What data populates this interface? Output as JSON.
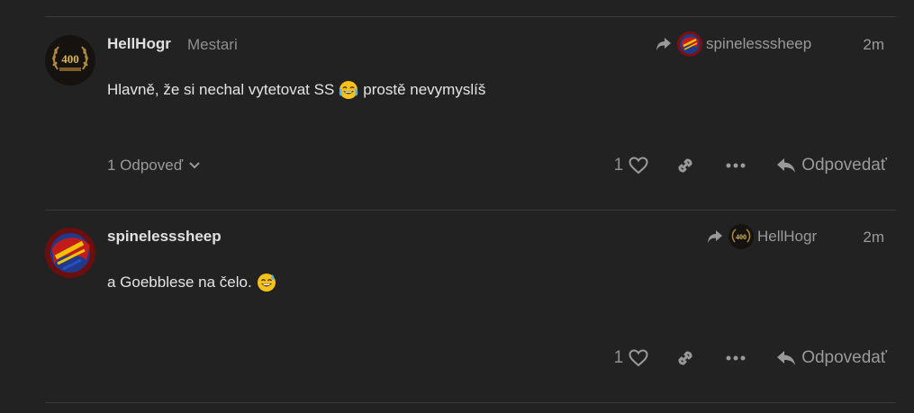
{
  "posts": [
    {
      "username": "HellHogr",
      "user_title": "Mestari",
      "avatar_icon": "gold-400-laurel-badge",
      "reply_to": {
        "username": "spinelesssheep",
        "avatar_icon": "colorful-helmet-avatar"
      },
      "time": "2m",
      "body_before_emoji": "Hlavně, že si nechal vytetovat SS",
      "emoji": "joy-emoji",
      "body_after_emoji": "prostě nevymyslíš",
      "replies_label": "1 Odpoveď",
      "like_count": "1",
      "reply_label": "Odpovedať"
    },
    {
      "username": "spinelesssheep",
      "user_title": "",
      "avatar_icon": "colorful-helmet-avatar",
      "reply_to": {
        "username": "HellHogr",
        "avatar_icon": "gold-400-laurel-badge"
      },
      "time": "2m",
      "body_before_emoji": "a Goebblese na čelo.",
      "emoji": "sweat-smile-emoji",
      "body_after_emoji": "",
      "replies_label": "",
      "like_count": "1",
      "reply_label": "Odpovedať"
    }
  ],
  "colors": {
    "background": "#222222",
    "divider": "#3a3a3a",
    "text": "#e4e4e4",
    "muted": "#9a9a9a"
  }
}
